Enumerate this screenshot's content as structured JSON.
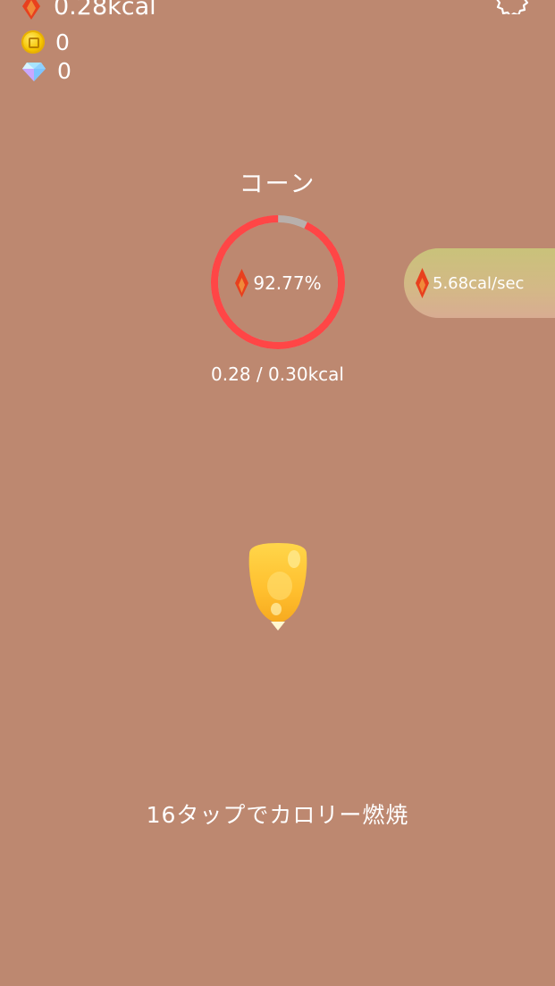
{
  "currencies": {
    "kcal": "0.28kcal",
    "coins": "0",
    "gems": "0"
  },
  "food": {
    "name": "コーン",
    "progress_percent_label": "92.77%",
    "progress_fraction": 0.9277,
    "kcal_progress": "0.28 / 0.30kcal",
    "rate": "5.68cal/sec"
  },
  "hint": "16タップでカロリー燃焼",
  "colors": {
    "background": "#bd8870",
    "ring_progress": "#ff4646",
    "ring_track": "#b8b0ac",
    "flame": "#e8401e"
  },
  "icons": {
    "kcal": "flame-icon",
    "coins": "coin-icon",
    "gems": "diamond-icon",
    "settings": "gear-icon",
    "food": "corn-kernel"
  }
}
